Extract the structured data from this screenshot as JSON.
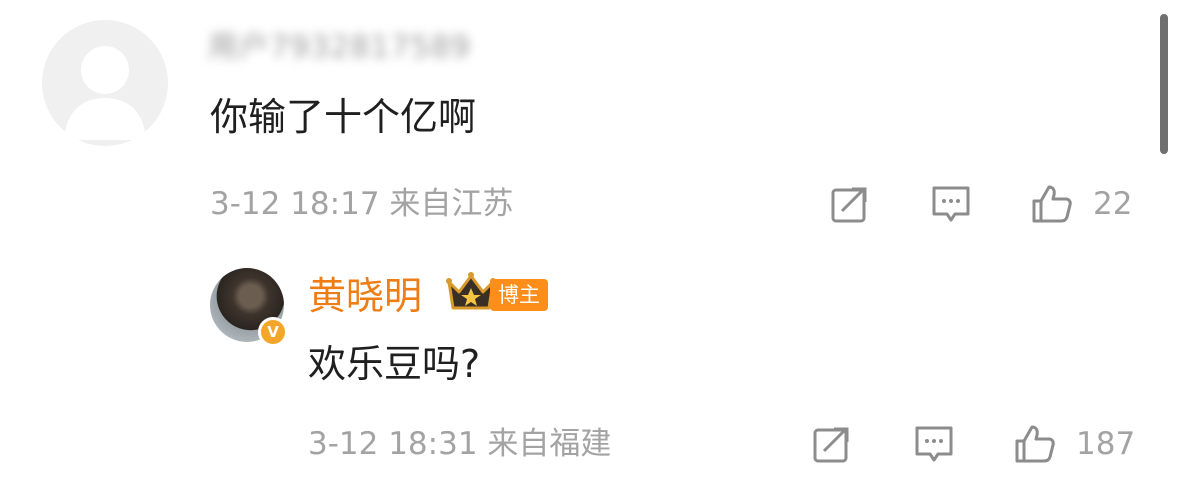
{
  "comments": [
    {
      "username": "用户7932817589",
      "text": "你输了十个亿啊",
      "date": "3-12 18:17",
      "location": "来自江苏",
      "likes": "22"
    }
  ],
  "reply": {
    "author": "黄晓明",
    "badge": "博主",
    "verified_mark": "V",
    "text": "欢乐豆吗?",
    "date": "3-12 18:31",
    "location": "来自福建",
    "likes": "187"
  },
  "colors": {
    "author_name": "#ef7d16",
    "badge_bg": "#ff8d1a",
    "meta_gray": "#a3a3a3",
    "icon_gray": "#8c8c8c"
  },
  "icons": {
    "repost": "repost-icon",
    "comment": "comment-icon",
    "like": "like-icon",
    "crown": "crown-icon"
  }
}
